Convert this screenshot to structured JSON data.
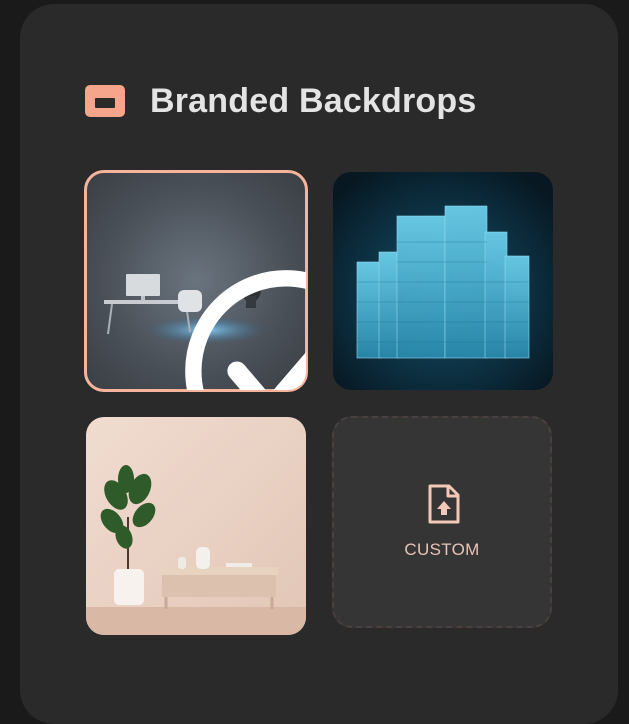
{
  "panel": {
    "title": "Branded Backdrops",
    "title_icon": "backdrop-folder-icon"
  },
  "backdrops": [
    {
      "name": "office-desk-backdrop",
      "selected": true
    },
    {
      "name": "city-skyline-backdrop",
      "selected": false
    },
    {
      "name": "living-room-backdrop",
      "selected": false
    }
  ],
  "custom": {
    "label": "CUSTOM",
    "icon": "file-upload-icon"
  },
  "colors": {
    "accent": "#f4a58c",
    "panel_bg": "#2a2a2a",
    "page_bg": "#1a1a1a",
    "title_text": "#e4e4e4",
    "custom_text": "#e8c4b6"
  }
}
